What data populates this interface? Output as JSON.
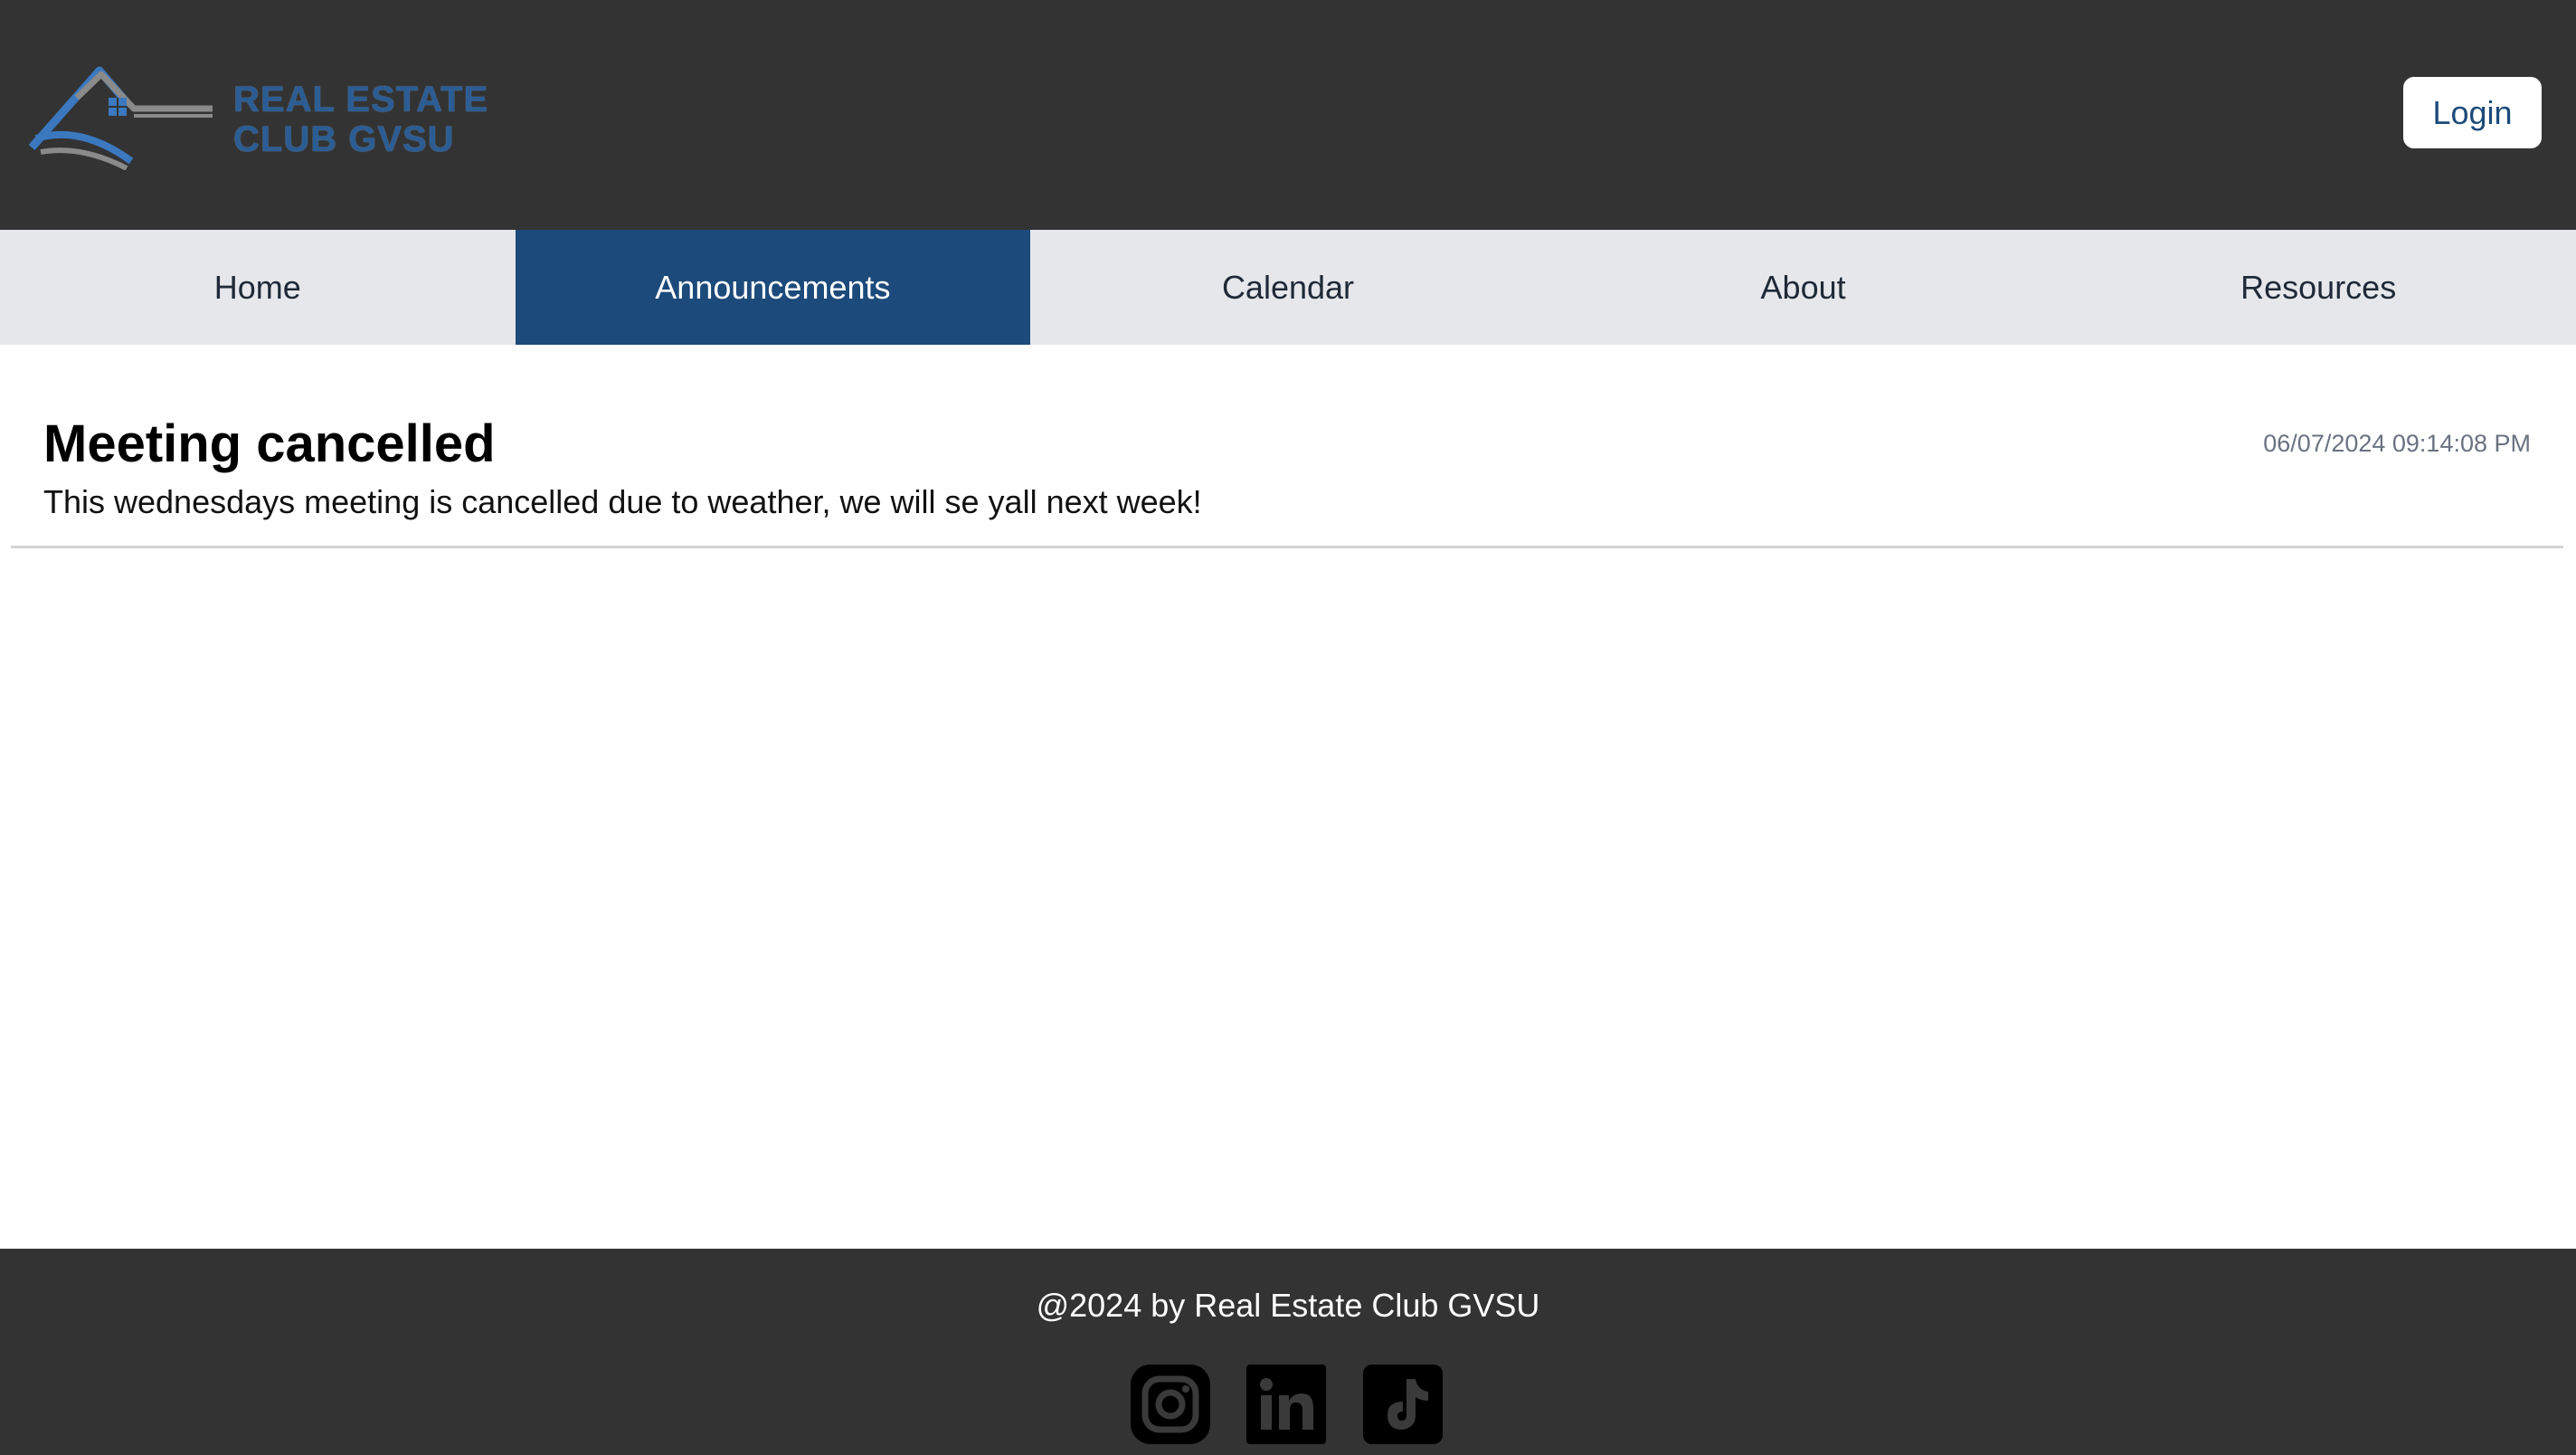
{
  "header": {
    "logo": {
      "line1": "REAL ESTATE",
      "line2": "CLUB GVSU"
    },
    "login_label": "Login"
  },
  "nav": {
    "items": [
      {
        "label": "Home",
        "active": false
      },
      {
        "label": "Announcements",
        "active": true
      },
      {
        "label": "Calendar",
        "active": false
      },
      {
        "label": "About",
        "active": false
      },
      {
        "label": "Resources",
        "active": false
      }
    ]
  },
  "announcement": {
    "title": "Meeting cancelled",
    "timestamp": "06/07/2024 09:14:08 PM",
    "body": "This wednesdays meeting is cancelled due to weather, we will se yall next week!"
  },
  "footer": {
    "copyright": "@2024 by Real Estate Club GVSU",
    "social": [
      {
        "name": "instagram-icon"
      },
      {
        "name": "linkedin-icon"
      },
      {
        "name": "tiktok-icon"
      }
    ]
  },
  "colors": {
    "header_bg": "#333333",
    "nav_bg": "#e5e7eb",
    "nav_active_bg": "#1c4a7b",
    "brand_blue": "#2b5d94",
    "login_text": "#1b4a7a"
  }
}
